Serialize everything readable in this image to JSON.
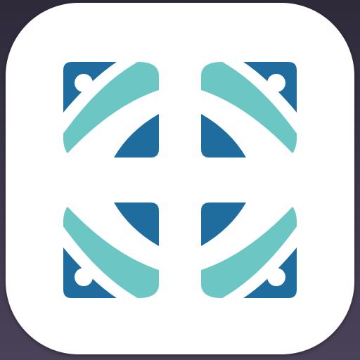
{
  "app_icon": {
    "icon": "four-quadrant-tile-logo-icon",
    "colors": {
      "background": "#ffffff",
      "dark_blue": "#1f6c9f",
      "teal": "#6cc6c4",
      "dot": "#ffffff"
    }
  }
}
